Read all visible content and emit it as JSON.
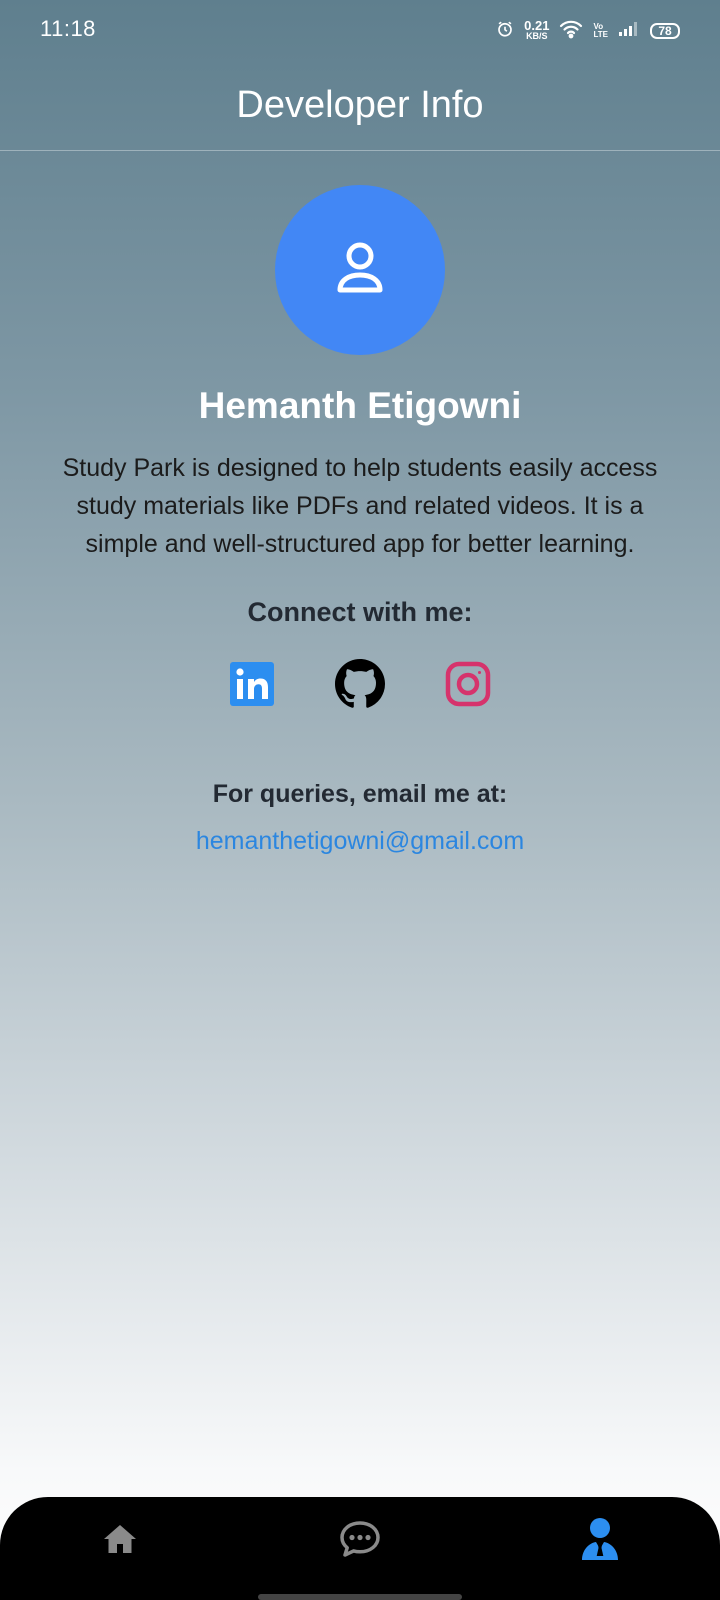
{
  "status_bar": {
    "time": "11:18",
    "net_speed_value": "0.21",
    "net_speed_unit": "KB/S",
    "volte_top": "Vo",
    "volte_bottom": "LTE",
    "battery": "78"
  },
  "header": {
    "title": "Developer Info"
  },
  "profile": {
    "avatar_icon": "user-outline-icon",
    "avatar_color": "#4287f5",
    "name": "Hemanth Etigowni",
    "description": "Study Park is designed to help students easily access study materials like PDFs and related videos. It is a simple and well-structured app for better learning."
  },
  "connect": {
    "heading": "Connect with me:",
    "links": [
      {
        "icon": "linkedin-icon",
        "color": "#2c8ef0"
      },
      {
        "icon": "github-icon",
        "color": "#000000"
      },
      {
        "icon": "instagram-icon",
        "color": "#d6336c"
      }
    ]
  },
  "contact": {
    "heading": "For queries, email me at:",
    "email": "hemanthetigowni@gmail.com"
  },
  "bottom_nav": {
    "items": [
      {
        "icon": "home-icon",
        "active": false
      },
      {
        "icon": "chat-icon",
        "active": false
      },
      {
        "icon": "developer-profile-icon",
        "active": true
      }
    ],
    "active_color": "#2c8ef0",
    "inactive_color": "#8a8a8a"
  }
}
